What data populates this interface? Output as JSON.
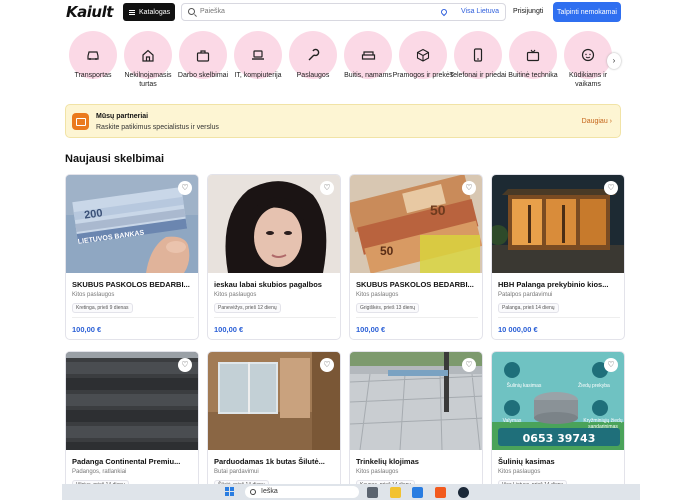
{
  "header": {
    "logo": "Kaiult",
    "catalog_label": "Katalogas",
    "search_placeholder": "Paieška",
    "location_label": "Visa Lietuva",
    "login_label": "Prisijungti",
    "post_label": "Talpinti nemokamai"
  },
  "categories": [
    {
      "label": "Transportas",
      "icon": "car-icon"
    },
    {
      "label": "Nekilnojamasis turtas",
      "icon": "house-icon"
    },
    {
      "label": "Darbo skelbimai",
      "icon": "briefcase-icon"
    },
    {
      "label": "IT, kompiuterija",
      "icon": "laptop-icon"
    },
    {
      "label": "Paslaugos",
      "icon": "wrench-icon"
    },
    {
      "label": "Buitis, namams",
      "icon": "sofa-icon"
    },
    {
      "label": "Pramogos ir prekės",
      "icon": "box-icon"
    },
    {
      "label": "Telefonai ir priedai",
      "icon": "phone-icon"
    },
    {
      "label": "Buitinė technika",
      "icon": "tv-icon"
    },
    {
      "label": "Kūdikiams ir vaikams",
      "icon": "baby-icon"
    }
  ],
  "partners": {
    "title": "Mūsų partneriai",
    "subtitle": "Raskite patikimus specialistus ir verslus",
    "link": "Daugiau"
  },
  "section_title": "Naujausi skelbimai",
  "listings": [
    {
      "title": "SKUBUS PASKOLOS BEDARBI...",
      "category": "Kitos paslaugos",
      "tag": "Kretinga, prieš 9 dienas",
      "price": "100,00 €",
      "image": "money-banknotes"
    },
    {
      "title": "ieskau labai skubios pagalbos",
      "category": "Kitos paslaugos",
      "tag": "Panevėžys, prieš 12 dienų",
      "price": "100,00 €",
      "image": "woman-portrait"
    },
    {
      "title": "SKUBUS PASKOLOS BEDARBI...",
      "category": "Kitos paslaugos",
      "tag": "Grigiškės, prieš 13 dienų",
      "price": "100,00 €",
      "image": "euro-banknotes"
    },
    {
      "title": "HBH Palanga prekybinio kios...",
      "category": "Patalpos pardavimui",
      "tag": "Palanga, prieš 14 dienų",
      "price": "10 000,00 €",
      "image": "kiosk-night"
    },
    {
      "title": "Padanga Continental Premiu...",
      "category": "Padangos, ratlankiai",
      "tag": "Vilnius, prieš 14 dienų",
      "price": "",
      "image": "tire"
    },
    {
      "title": "Parduodamas 1k butas Šilutė...",
      "category": "Butai pardavimui",
      "tag": "Šilutė, prieš 14 dienų",
      "price": "",
      "image": "apartment-room"
    },
    {
      "title": "Trinkelių klojimas",
      "category": "Kitos paslaugos",
      "tag": "Kaunas, prieš 14 dienų",
      "price": "",
      "image": "paving-tiles"
    },
    {
      "title": "Šulinių kasimas",
      "category": "Kitos paslaugos",
      "tag": "Visa Lietuva, prieš 14 dienų",
      "price": "",
      "image": "well-ad"
    }
  ],
  "well_ad": {
    "labels": [
      "Šulinių kasimas",
      "Žiedų prekyba",
      "Valymas",
      "Kryžminiųjų žiedų sandarinimas"
    ],
    "phone": "0653 39743"
  },
  "taskbar": {
    "search_placeholder": "Ieška"
  }
}
